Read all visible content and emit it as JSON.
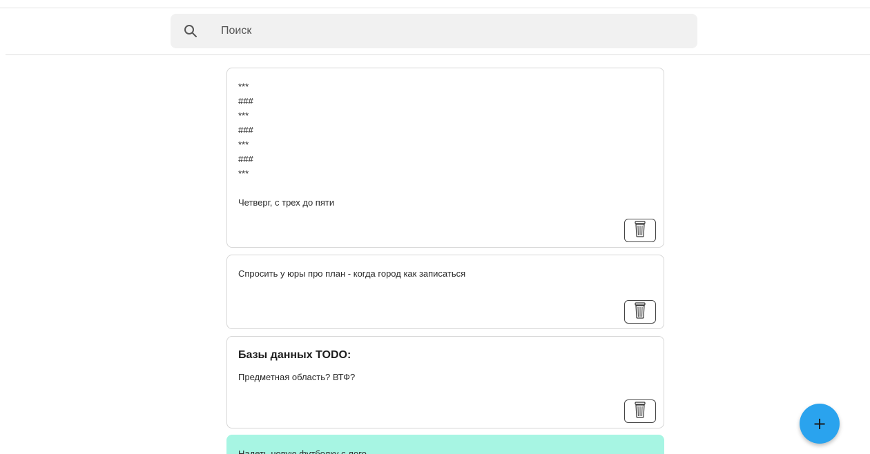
{
  "search": {
    "placeholder": "Поиск"
  },
  "notes": [
    {
      "title": "",
      "body": "***\n###\n***\n###\n***\n###\n***\n\nЧетверг, с трех до пяти"
    },
    {
      "title": "",
      "body": "Спросить у юры про план - когда город как записаться"
    },
    {
      "title": "Базы данных TODO:",
      "body": "Предметная область? ВТФ?"
    },
    {
      "title": "",
      "body": "Надеть новую футболку с лого"
    }
  ],
  "fab": {
    "label": "+"
  },
  "colors": {
    "accent": "#2aa3ee",
    "note_green": "#a7f5e3",
    "search_bg": "#f1f1f1"
  },
  "icons": {
    "search": "search-icon",
    "delete": "trash-icon",
    "add": "plus-icon"
  }
}
